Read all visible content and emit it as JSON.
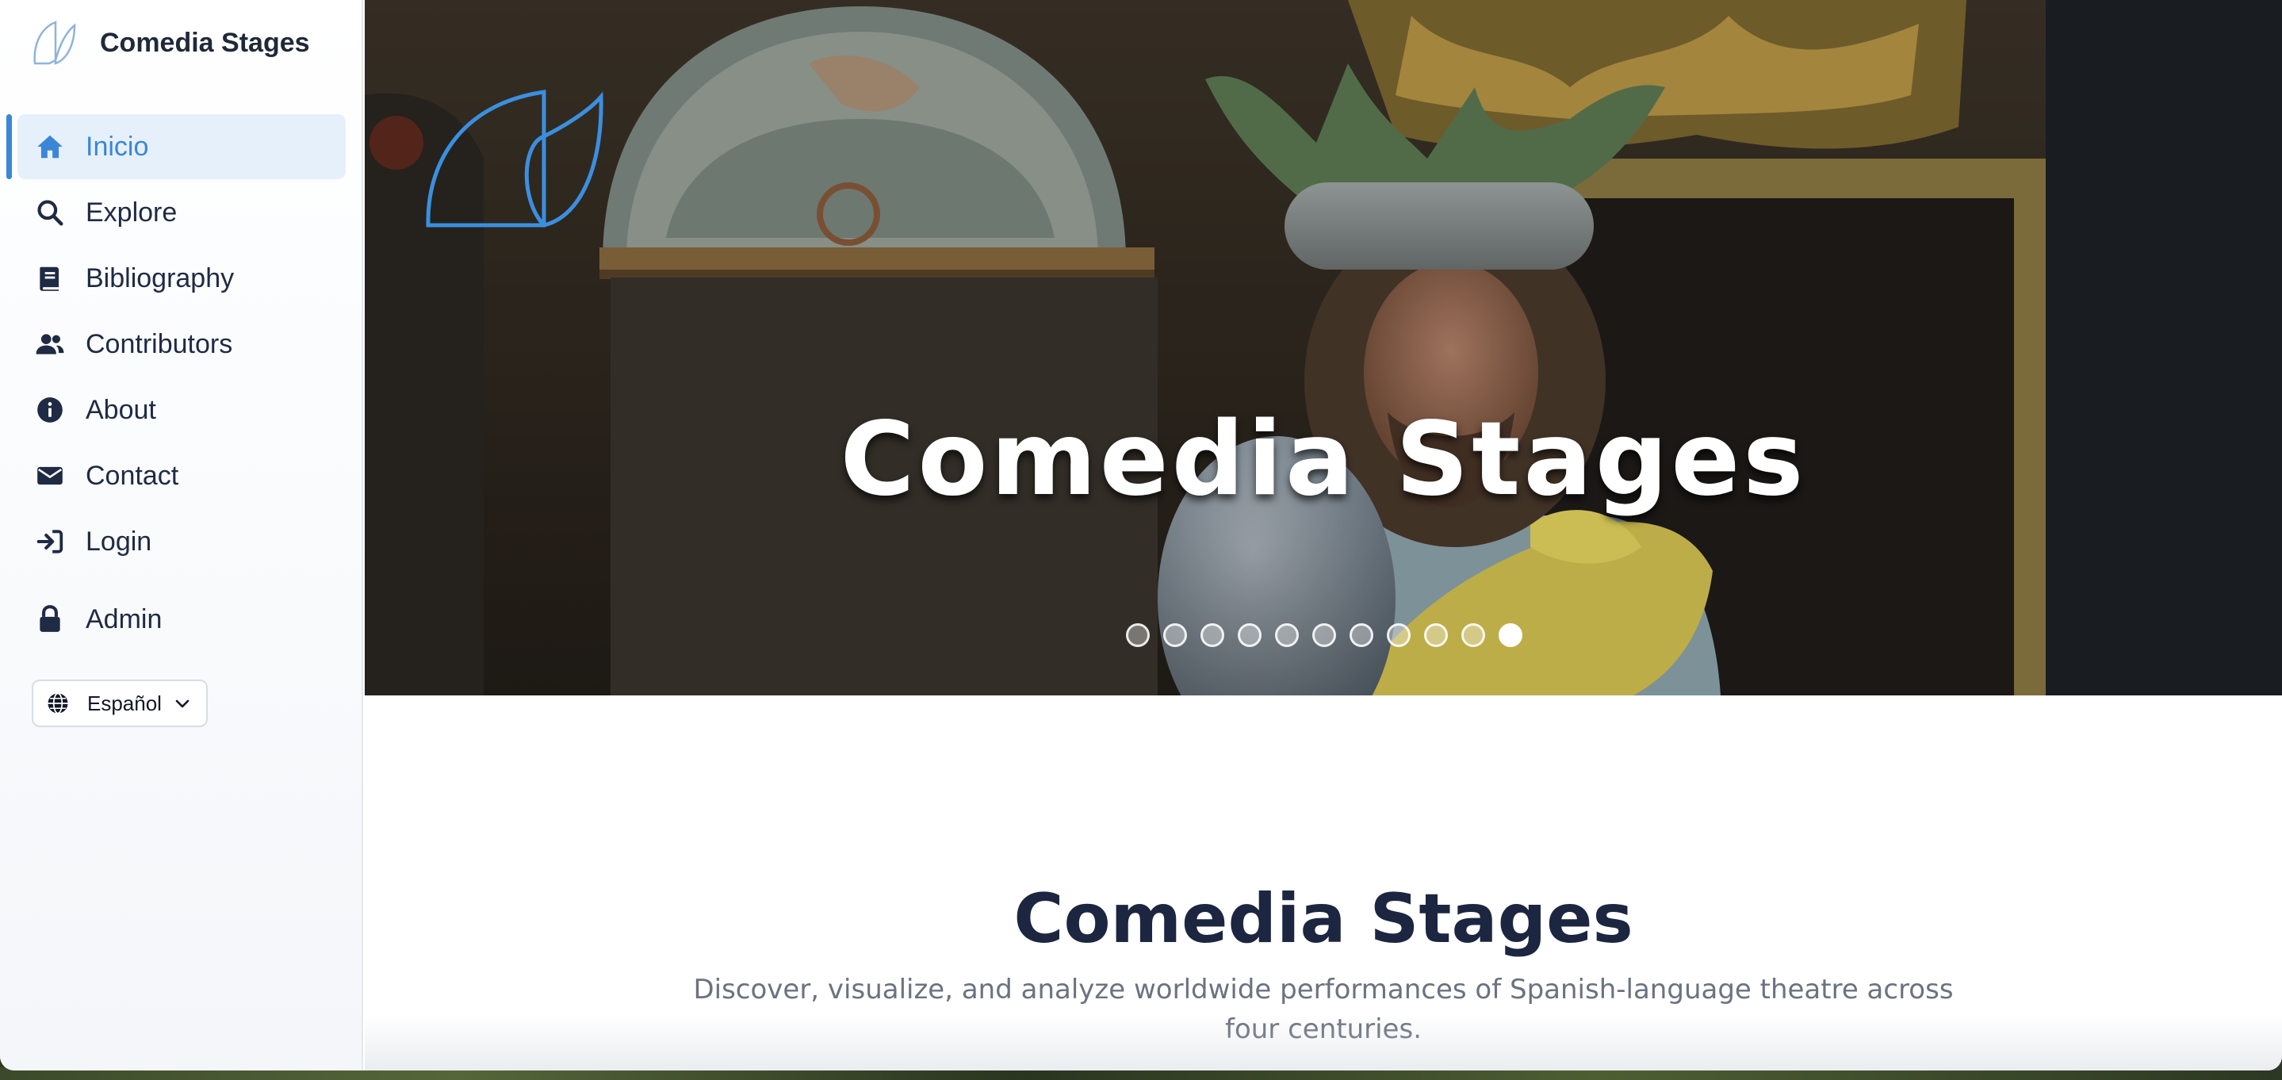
{
  "app": {
    "title": "Comedia Stages"
  },
  "sidebar": {
    "brand_name": "Comedia Stages",
    "items": [
      {
        "label": "Inicio",
        "icon": "home-icon",
        "active": true
      },
      {
        "label": "Explore",
        "icon": "search-icon",
        "active": false
      },
      {
        "label": "Bibliography",
        "icon": "book-icon",
        "active": false
      },
      {
        "label": "Contributors",
        "icon": "users-icon",
        "active": false
      },
      {
        "label": "About",
        "icon": "info-icon",
        "active": false
      },
      {
        "label": "Contact",
        "icon": "envelope-icon",
        "active": false
      },
      {
        "label": "Login",
        "icon": "sign-in-icon",
        "active": false
      },
      {
        "label": "Admin",
        "icon": "lock-icon",
        "active": false
      }
    ],
    "language": {
      "selected": "Español",
      "icon": "globe-icon"
    }
  },
  "hero": {
    "title": "Comedia Stages",
    "slide_count": 11,
    "active_slide": 11
  },
  "intro": {
    "title": "Comedia Stages",
    "subtitle": "Discover, visualize, and analyze worldwide performances of Spanish-language theatre across four centuries."
  },
  "colors": {
    "accent": "#3b86d6",
    "active_bg": "#e6f0fa",
    "text_dark": "#1c2640",
    "text_muted": "#6b7280"
  }
}
